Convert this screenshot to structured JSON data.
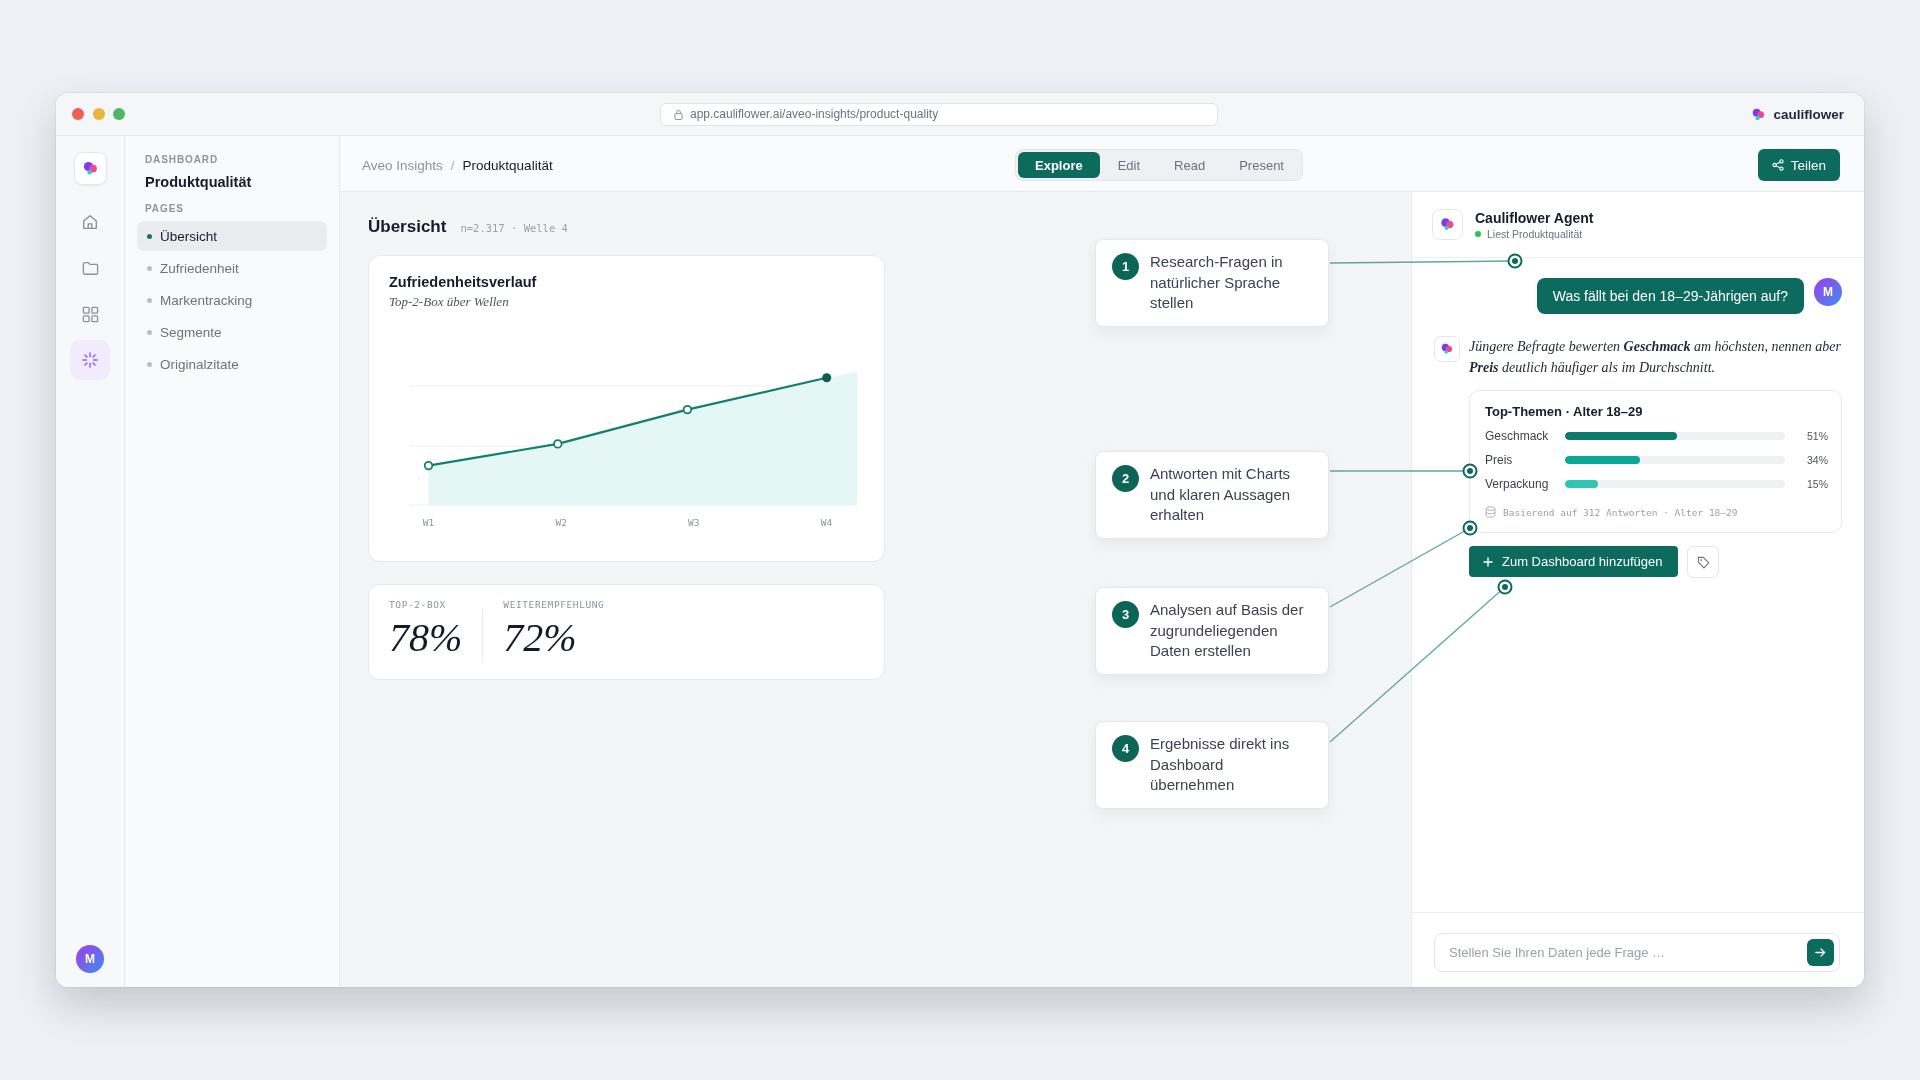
{
  "window": {
    "url": "app.cauliflower.ai/aveo-insights/product-quality",
    "brand": "cauliflower"
  },
  "icon_rail": {
    "items": [
      {
        "kind": "home",
        "selected": false
      },
      {
        "kind": "folder",
        "selected": false
      },
      {
        "kind": "grid",
        "selected": false
      },
      {
        "kind": "sparkle",
        "selected": true
      }
    ],
    "avatar": "M"
  },
  "sidebar": {
    "section": "DASHBOARD",
    "title": "Produktqualität",
    "group_label": "PAGES",
    "items": [
      {
        "label": "Übersicht",
        "selected": true
      },
      {
        "label": "Zufriedenheit",
        "selected": false
      },
      {
        "label": "Markentracking",
        "selected": false
      },
      {
        "label": "Segmente",
        "selected": false
      },
      {
        "label": "Originalzitate",
        "selected": false
      }
    ]
  },
  "header": {
    "breadcrumb": [
      "Aveo Insights",
      "Produktqualität"
    ],
    "separator": "/",
    "modes": [
      {
        "label": "Explore",
        "selected": true
      },
      {
        "label": "Edit",
        "selected": false
      },
      {
        "label": "Read",
        "selected": false
      },
      {
        "label": "Present",
        "selected": false
      }
    ],
    "share_button": "Teilen"
  },
  "overview": {
    "title": "Übersicht",
    "meta": "n=2.317 · Welle 4",
    "trend_card": {
      "title": "Zufriedenheitsverlauf",
      "subtitle": "Top-2-Box über Wellen",
      "x_labels": [
        "W1",
        "W2",
        "W3",
        "W4"
      ]
    },
    "kpis": [
      {
        "label": "TOP-2-BOX",
        "value": "78%"
      },
      {
        "label": "WEITEREMPFEHLUNG",
        "value": "72%"
      }
    ]
  },
  "callouts": [
    {
      "number": "1",
      "text": "Research-Fragen in natürlicher Sprache stellen"
    },
    {
      "number": "2",
      "text": "Antworten mit Charts und klaren Aussagen erhalten"
    },
    {
      "number": "3",
      "text": "Analysen auf Basis der zugrundeliegenden Daten erstellen"
    },
    {
      "number": "4",
      "text": "Ergebnisse direkt ins Dashboard übernehmen"
    }
  ],
  "agent": {
    "name": "Cauliflower Agent",
    "status": "Liest Produktqualität",
    "user_message": {
      "avatar": "M",
      "text": "Was fällt bei den 18–29-Jährigen auf?"
    },
    "reply": {
      "text": "Jüngere Befragte bewerten **Geschmack** am höchsten, nennen aber **Preis** deutlich häufiger als im Durchschnitt.",
      "result_card": {
        "title": "Top-Themen · Alter 18–29",
        "bars": [
          {
            "label": "Geschmack",
            "level": 0.51,
            "reading": "51%",
            "color": "#0b7b6d"
          },
          {
            "label": "Preis",
            "level": 0.34,
            "reading": "34%",
            "color": "#0aa896"
          },
          {
            "label": "Verpackung",
            "level": 0.15,
            "reading": "15%",
            "color": "#30c4b2"
          }
        ],
        "footnote": "Basierend auf 312 Antworten · Alter 18–29"
      },
      "add_button": "Zum Dashboard hinzufügen"
    },
    "input": {
      "placeholder": "Stellen Sie Ihren Daten jede Frage …"
    }
  }
}
